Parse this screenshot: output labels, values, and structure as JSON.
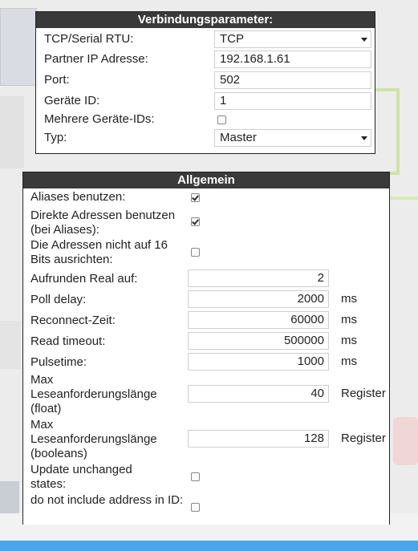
{
  "connection_panel": {
    "title": "Verbindungsparameter:",
    "fields": [
      {
        "label": "TCP/Serial RTU:",
        "value": "TCP"
      },
      {
        "label": "Partner IP Adresse:",
        "value": "192.168.1.61"
      },
      {
        "label": "Port:",
        "value": "502"
      },
      {
        "label": "Geräte ID:",
        "value": "1"
      },
      {
        "label": "Mehrere Geräte-IDs:",
        "checked": false
      },
      {
        "label": "Typ:",
        "value": "Master"
      }
    ]
  },
  "general_panel": {
    "title": "Allgemein",
    "aliases": {
      "label": "Aliases benutzen:",
      "checked": true
    },
    "direct_addresses": {
      "label": "Direkte Adressen benutzen (bei Aliases):",
      "checked": true
    },
    "no_align_16": {
      "label": "Die Adressen nicht auf 16 Bits ausrichten:",
      "checked": false
    },
    "round_real": {
      "label": "Aufrunden Real auf:",
      "value": "2"
    },
    "poll_delay": {
      "label": "Poll delay:",
      "value": "2000",
      "unit": "ms"
    },
    "reconnect": {
      "label": "Reconnect-Zeit:",
      "value": "60000",
      "unit": "ms"
    },
    "read_timeout": {
      "label": "Read timeout:",
      "value": "500000",
      "unit": "ms"
    },
    "pulsetime": {
      "label": "Pulsetime:",
      "value": "1000",
      "unit": "ms"
    },
    "max_read_float": {
      "label": "Max Leseanforderungslänge (float)",
      "value": "40",
      "unit": "Register"
    },
    "max_read_bool": {
      "label": "Max Leseanforderungslänge (booleans)",
      "value": "128",
      "unit": "Register"
    },
    "update_unchanged": {
      "label": "Update unchanged states:",
      "checked": false
    },
    "no_address_in_id": {
      "label": "do not include address in ID:",
      "checked": false
    }
  },
  "colors": {
    "title_bar": "#3a3a3a",
    "bottom_bar": "#4aa6e8"
  }
}
